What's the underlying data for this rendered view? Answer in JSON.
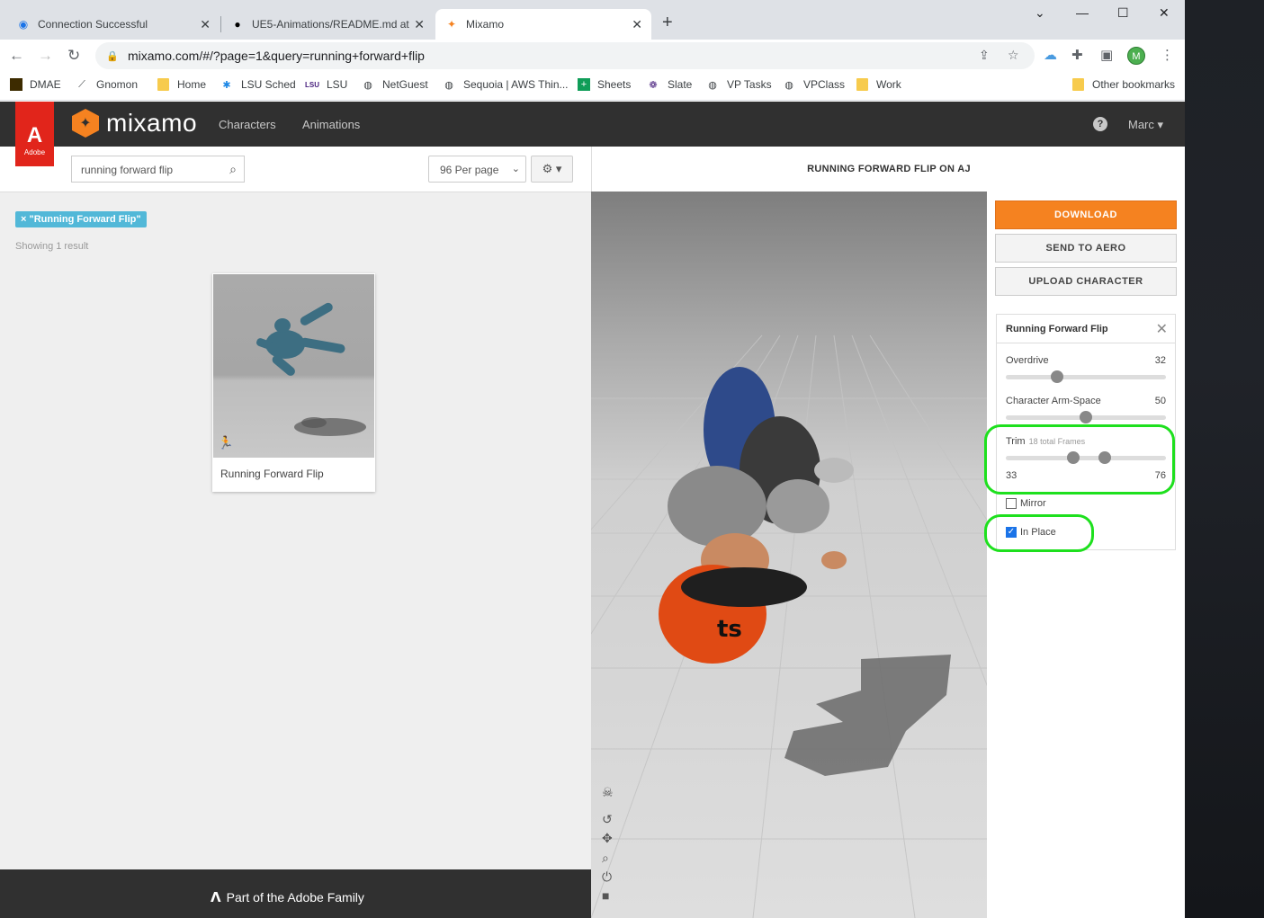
{
  "browser": {
    "tabs": [
      {
        "title": "Connection Successful",
        "icon": "globe-icon"
      },
      {
        "title": "UE5-Animations/README.md at",
        "icon": "github-icon"
      },
      {
        "title": "Mixamo",
        "icon": "mixamo-icon"
      }
    ],
    "url": "mixamo.com/#/?page=1&query=running+forward+flip",
    "bookmarks": [
      "DMAE",
      "Gnomon",
      "Home",
      "LSU Sched",
      "LSU",
      "NetGuest",
      "Sequoia | AWS Thin...",
      "Sheets",
      "Slate",
      "VP Tasks",
      "VPClass",
      "Work"
    ],
    "other_bookmarks": "Other bookmarks",
    "profile_initial": "M"
  },
  "header": {
    "adobe_badge": "Adobe",
    "logo": "mixamo",
    "nav": [
      "Characters",
      "Animations"
    ],
    "user": "Marc"
  },
  "search": {
    "query": "running forward flip",
    "per_page": "96 Per page",
    "filter_tag": "× \"Running Forward Flip\"",
    "result_count": "Showing 1 result"
  },
  "results": [
    {
      "title": "Running Forward Flip"
    }
  ],
  "footer": {
    "text": "Part of the Adobe Family"
  },
  "preview": {
    "title": "RUNNING FORWARD FLIP ON AJ"
  },
  "actions": {
    "download": "DOWNLOAD",
    "send": "SEND TO AERO",
    "upload": "UPLOAD CHARACTER"
  },
  "settings": {
    "title": "Running Forward Flip",
    "overdrive": {
      "label": "Overdrive",
      "value": "32",
      "fraction": 0.32
    },
    "arm_space": {
      "label": "Character Arm-Space",
      "value": "50",
      "fraction": 0.5
    },
    "trim": {
      "label": "Trim",
      "sub": "18 total Frames",
      "start": "33",
      "end": "76",
      "start_fraction": 0.42,
      "end_fraction": 0.62
    },
    "mirror": {
      "label": "Mirror",
      "checked": false
    },
    "in_place": {
      "label": "In Place",
      "checked": true
    }
  },
  "colors": {
    "accent": "#f58220",
    "highlight": "#1ee01e",
    "header_bg": "#303030",
    "tag": "#52b8d8"
  }
}
